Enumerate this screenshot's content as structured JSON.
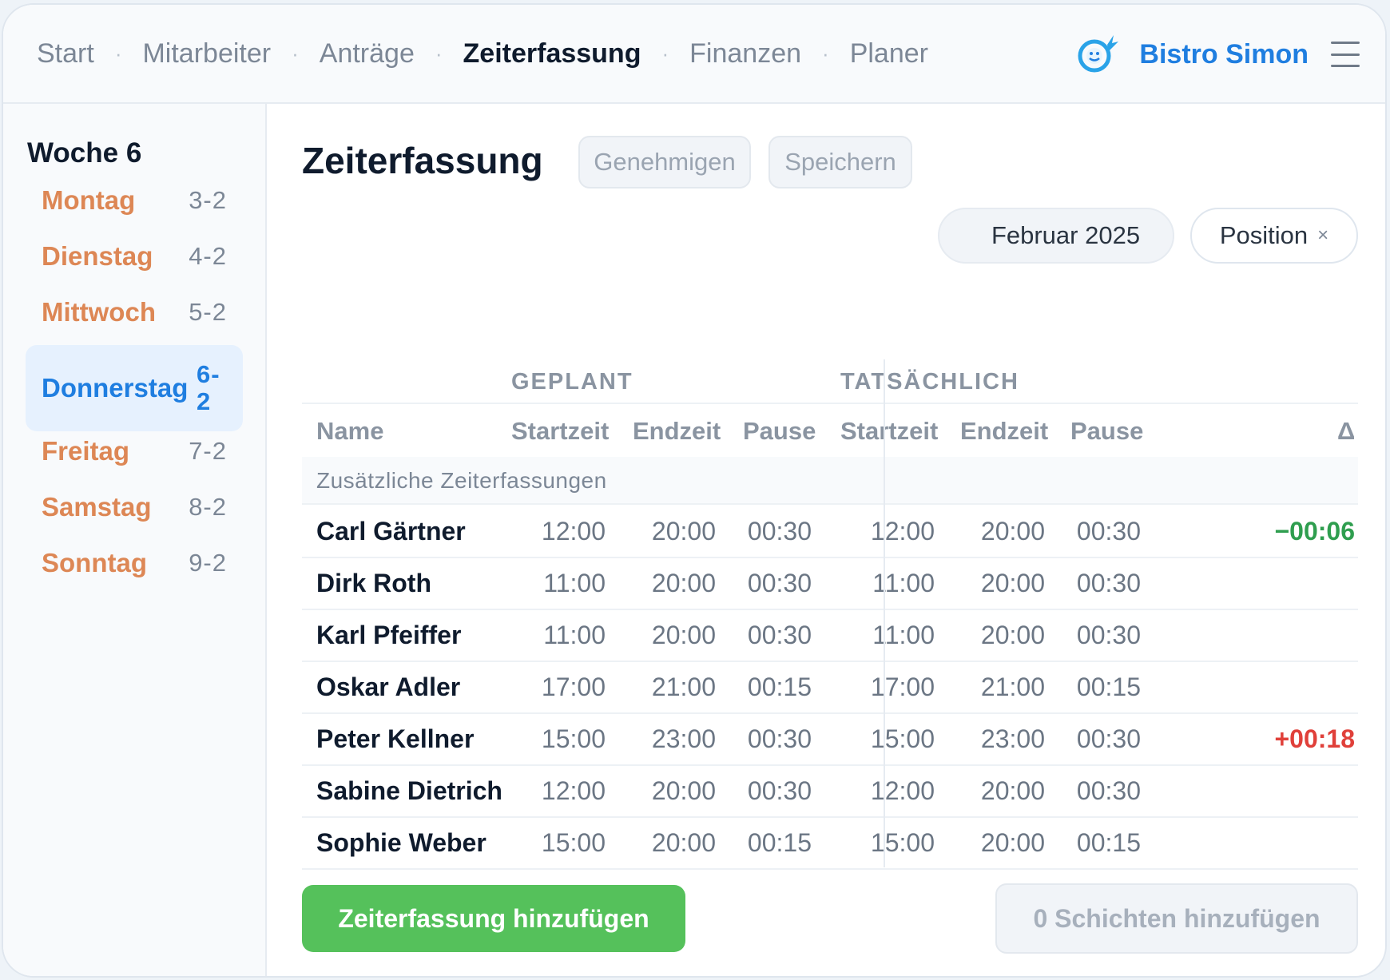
{
  "nav": {
    "items": [
      "Start",
      "Mitarbeiter",
      "Anträge",
      "Zeiterfassung",
      "Finanzen",
      "Planer"
    ],
    "separator": "·",
    "active": "Zeiterfassung"
  },
  "brand": {
    "name": "Bistro Simon",
    "logo_icon": "smiley-logo-icon",
    "accent": "#1f7ee0"
  },
  "sidebar": {
    "week_title": "Woche 6",
    "days": [
      {
        "label": "Montag",
        "date": "3-2"
      },
      {
        "label": "Dienstag",
        "date": "4-2"
      },
      {
        "label": "Mittwoch",
        "date": "5-2"
      },
      {
        "label": "Donnerstag",
        "date": "6-2"
      },
      {
        "label": "Freitag",
        "date": "7-2"
      },
      {
        "label": "Samstag",
        "date": "8-2"
      },
      {
        "label": "Sonntag",
        "date": "9-2"
      }
    ],
    "active_day": "Donnerstag",
    "day_color": "#dd8755"
  },
  "main": {
    "title": "Zeiterfassung",
    "approve_label": "Genehmigen",
    "save_label": "Speichern",
    "month_filter": "Februar 2025",
    "position_filter": "Position",
    "position_clear": "×"
  },
  "table": {
    "group_planned": "GEPLANT",
    "group_actual": "TATSÄCHLICH",
    "columns": [
      "Name",
      "Startzeit",
      "Endzeit",
      "Pause",
      "Startzeit",
      "Endzeit",
      "Pause",
      "Δ"
    ],
    "section_label": "Zusätzliche Zeiterfassungen",
    "rows": [
      {
        "name": "Carl Gärtner",
        "plan_start": "12:00",
        "plan_end": "20:00",
        "plan_break": "00:30",
        "act_start": "12:00",
        "act_end": "20:00",
        "act_break": "00:30",
        "delta": "−00:06",
        "delta_color": "#2f9e4f"
      },
      {
        "name": "Dirk Roth",
        "plan_start": "11:00",
        "plan_end": "20:00",
        "plan_break": "00:30",
        "act_start": "11:00",
        "act_end": "20:00",
        "act_break": "00:30",
        "delta": "",
        "delta_color": ""
      },
      {
        "name": "Karl Pfeiffer",
        "plan_start": "11:00",
        "plan_end": "20:00",
        "plan_break": "00:30",
        "act_start": "11:00",
        "act_end": "20:00",
        "act_break": "00:30",
        "delta": "",
        "delta_color": ""
      },
      {
        "name": "Oskar Adler",
        "plan_start": "17:00",
        "plan_end": "21:00",
        "plan_break": "00:15",
        "act_start": "17:00",
        "act_end": "21:00",
        "act_break": "00:15",
        "delta": "",
        "delta_color": ""
      },
      {
        "name": "Peter Kellner",
        "plan_start": "15:00",
        "plan_end": "23:00",
        "plan_break": "00:30",
        "act_start": "15:00",
        "act_end": "23:00",
        "act_break": "00:30",
        "delta": "+00:18",
        "delta_color": "#e0403a"
      },
      {
        "name": "Sabine Dietrich",
        "plan_start": "12:00",
        "plan_end": "20:00",
        "plan_break": "00:30",
        "act_start": "12:00",
        "act_end": "20:00",
        "act_break": "00:30",
        "delta": "",
        "delta_color": ""
      },
      {
        "name": "Sophie Weber",
        "plan_start": "15:00",
        "plan_end": "20:00",
        "plan_break": "00:15",
        "act_start": "15:00",
        "act_end": "20:00",
        "act_break": "00:15",
        "delta": "",
        "delta_color": ""
      }
    ]
  },
  "footer": {
    "add_entry_label": "Zeiterfassung hinzufügen",
    "add_shifts_label": "0 Schichten hinzufügen"
  }
}
